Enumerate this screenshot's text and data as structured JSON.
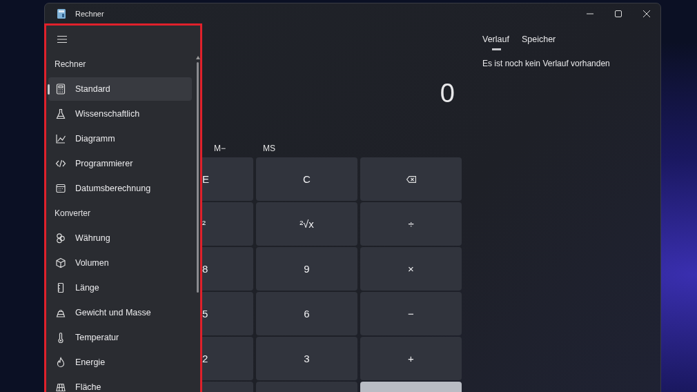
{
  "window": {
    "title": "Rechner"
  },
  "navigation": {
    "sections": [
      {
        "header": "Rechner",
        "items": [
          {
            "label": "Standard",
            "selected": true
          },
          {
            "label": "Wissenschaftlich",
            "selected": false
          },
          {
            "label": "Diagramm",
            "selected": false
          },
          {
            "label": "Programmierer",
            "selected": false
          },
          {
            "label": "Datumsberechnung",
            "selected": false
          }
        ]
      },
      {
        "header": "Konverter",
        "items": [
          {
            "label": "Währung",
            "selected": false
          },
          {
            "label": "Volumen",
            "selected": false
          },
          {
            "label": "Länge",
            "selected": false
          },
          {
            "label": "Gewicht und Masse",
            "selected": false
          },
          {
            "label": "Temperatur",
            "selected": false
          },
          {
            "label": "Energie",
            "selected": false
          },
          {
            "label": "Fläche",
            "selected": false
          }
        ]
      }
    ]
  },
  "display": {
    "value": "0"
  },
  "memory_buttons": [
    "M−",
    "MS"
  ],
  "keypad": [
    [
      {
        "kind": "text",
        "label": "E"
      },
      {
        "kind": "text",
        "label": "C"
      },
      {
        "kind": "backspace"
      }
    ],
    [
      {
        "kind": "text",
        "label": "²"
      },
      {
        "kind": "text",
        "label": "²√x"
      },
      {
        "kind": "text",
        "label": "÷"
      }
    ],
    [
      {
        "kind": "text",
        "label": "8"
      },
      {
        "kind": "text",
        "label": "9"
      },
      {
        "kind": "text",
        "label": "×"
      }
    ],
    [
      {
        "kind": "text",
        "label": "5"
      },
      {
        "kind": "text",
        "label": "6"
      },
      {
        "kind": "text",
        "label": "−"
      }
    ],
    [
      {
        "kind": "text",
        "label": "2"
      },
      {
        "kind": "text",
        "label": "3"
      },
      {
        "kind": "text",
        "label": "+"
      }
    ],
    [
      {
        "kind": "blank"
      },
      {
        "kind": "blank"
      },
      {
        "kind": "accent"
      }
    ]
  ],
  "history": {
    "tabs": [
      {
        "label": "Verlauf",
        "selected": true
      },
      {
        "label": "Speicher",
        "selected": false
      }
    ],
    "message": "Es ist noch kein Verlauf vorhanden"
  }
}
